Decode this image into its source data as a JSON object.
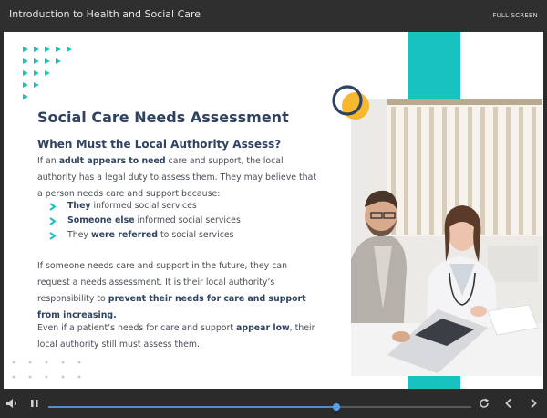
{
  "header": {
    "course_title": "Introduction to Health and Social Care",
    "fullscreen_label": "FULL SCREEN"
  },
  "slide": {
    "title": "Social Care Needs Assessment",
    "subtitle": "When Must the Local Authority Assess?",
    "intro": {
      "t1": "If an ",
      "b1": "adult appears to need",
      "t2": " care and support, the local authority has a legal duty to assess them. They may believe that a person needs care and support because:"
    },
    "bullets": [
      {
        "bold": "They",
        "rest": " informed social services",
        "bold_after": "",
        "tail": ""
      },
      {
        "bold": "Someone else",
        "rest": " informed social services",
        "bold_after": "",
        "tail": ""
      },
      {
        "bold": "",
        "rest": "They ",
        "bold_after": "were referred",
        "tail": " to social services"
      }
    ],
    "future": {
      "t1": "If someone needs care and support in the future, they can request a needs assessment. It is their local authority’s responsibility to ",
      "b1": "prevent their needs for care and support from increasing."
    },
    "low": {
      "t1": "Even if a patient’s needs for care and support ",
      "b1": "appear low",
      "t2": ", their local authority still must assess them."
    }
  },
  "colors": {
    "teal": "#17c2bf",
    "navy": "#2f4260",
    "yellow": "#f5b82e",
    "progress": "#4a8fd8"
  },
  "player": {
    "progress": 0.68,
    "icons": [
      "volume-icon",
      "pause-icon",
      "replay-icon",
      "previous-icon",
      "next-icon"
    ]
  }
}
